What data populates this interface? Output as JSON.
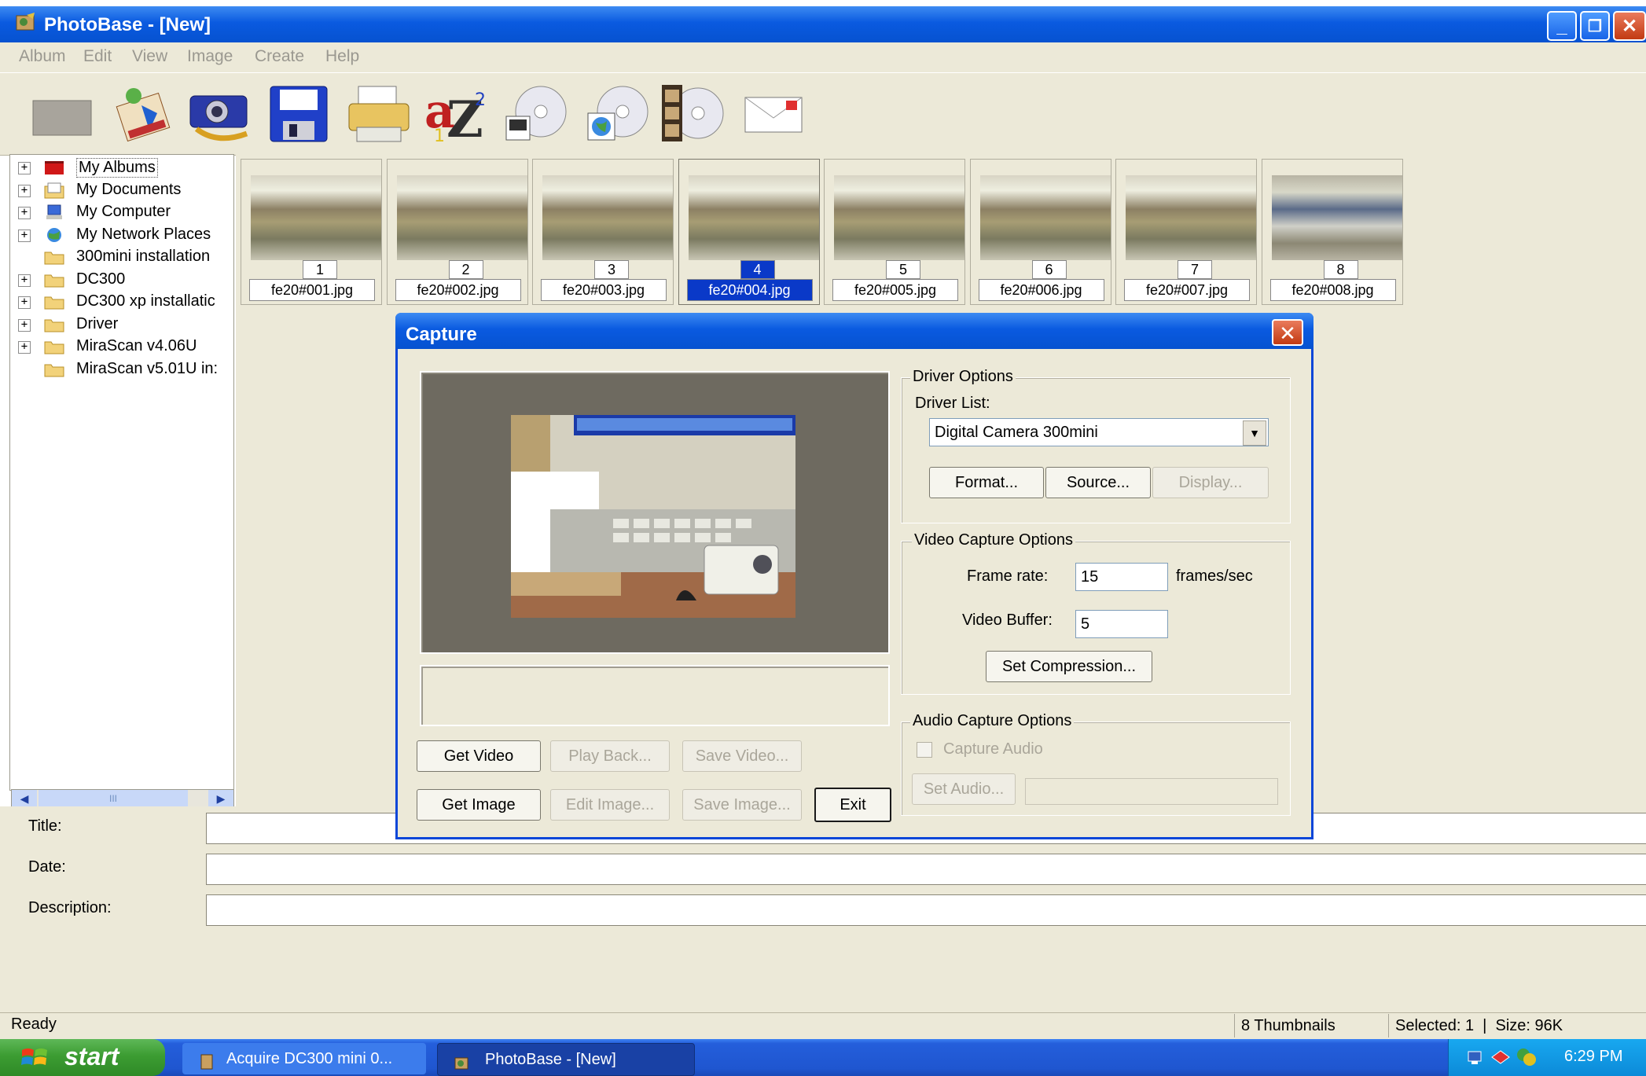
{
  "window": {
    "title": "PhotoBase - [New]",
    "min_glyph": "_",
    "max_glyph": "❐",
    "close_glyph": "✕"
  },
  "menu": [
    "Album",
    "Edit",
    "View",
    "Image",
    "Create",
    "Help"
  ],
  "toolbar_icons": [
    "blank-tool-icon",
    "music-album-icon",
    "camera-icon",
    "save-disk-icon",
    "printer-icon",
    "sort-az-icon",
    "cd-image-icon",
    "cd-web-icon",
    "cd-video-icon",
    "email-icon"
  ],
  "tree": {
    "items": [
      {
        "label": "My Albums",
        "expandable": true,
        "icon": "album-icon"
      },
      {
        "label": "My Documents",
        "expandable": true,
        "icon": "documents-icon"
      },
      {
        "label": "My Computer",
        "expandable": true,
        "icon": "computer-icon"
      },
      {
        "label": "My Network Places",
        "expandable": true,
        "icon": "network-icon"
      },
      {
        "label": "300mini installation",
        "expandable": false,
        "icon": "folder-icon"
      },
      {
        "label": "DC300",
        "expandable": true,
        "icon": "folder-icon"
      },
      {
        "label": "DC300 xp installatic",
        "expandable": true,
        "icon": "folder-icon"
      },
      {
        "label": "Driver",
        "expandable": true,
        "icon": "folder-icon"
      },
      {
        "label": "MiraScan v4.06U",
        "expandable": true,
        "icon": "folder-icon"
      },
      {
        "label": "MiraScan v5.01U in:",
        "expandable": false,
        "icon": "folder-icon"
      }
    ],
    "plus": "+",
    "scroll_left": "◀",
    "scroll_mid": "III",
    "scroll_right": "▶"
  },
  "thumbnails": [
    {
      "num": "1",
      "name": "fe20#001.jpg",
      "selected": false
    },
    {
      "num": "2",
      "name": "fe20#002.jpg",
      "selected": false
    },
    {
      "num": "3",
      "name": "fe20#003.jpg",
      "selected": false
    },
    {
      "num": "4",
      "name": "fe20#004.jpg",
      "selected": true
    },
    {
      "num": "5",
      "name": "fe20#005.jpg",
      "selected": false
    },
    {
      "num": "6",
      "name": "fe20#006.jpg",
      "selected": false
    },
    {
      "num": "7",
      "name": "fe20#007.jpg",
      "selected": false
    },
    {
      "num": "8",
      "name": "fe20#008.jpg",
      "selected": false
    }
  ],
  "info": {
    "title_label": "Title:",
    "date_label": "Date:",
    "description_label": "Description:",
    "title_value": "",
    "date_value": "",
    "description_value": ""
  },
  "status": {
    "ready": "Ready",
    "thumbnails": "8 Thumbnails",
    "selected": "Selected: 1  |  Size: 96K"
  },
  "taskbar": {
    "start": "start",
    "task1": "Acquire DC300 mini 0...",
    "task2": "PhotoBase - [New]",
    "clock": "6:29 PM"
  },
  "dialog": {
    "title": "Capture",
    "close_glyph": "✕",
    "driver_group": "Driver Options",
    "driver_list_label": "Driver List:",
    "driver_selected": "Digital Camera 300mini",
    "dropdown_arrow": "▼",
    "format_btn": "Format...",
    "source_btn": "Source...",
    "display_btn": "Display...",
    "video_group": "Video Capture Options",
    "frame_rate_label": "Frame rate:",
    "frame_rate_value": "15",
    "frame_rate_unit": "frames/sec",
    "video_buffer_label": "Video Buffer:",
    "video_buffer_value": "5",
    "set_compression_btn": "Set Compression...",
    "audio_group": "Audio Capture Options",
    "capture_audio_label": "Capture Audio",
    "set_audio_btn": "Set Audio...",
    "get_video_btn": "Get Video",
    "play_back_btn": "Play Back...",
    "save_video_btn": "Save Video...",
    "get_image_btn": "Get Image",
    "edit_image_btn": "Edit Image...",
    "save_image_btn": "Save Image...",
    "exit_btn": "Exit"
  }
}
